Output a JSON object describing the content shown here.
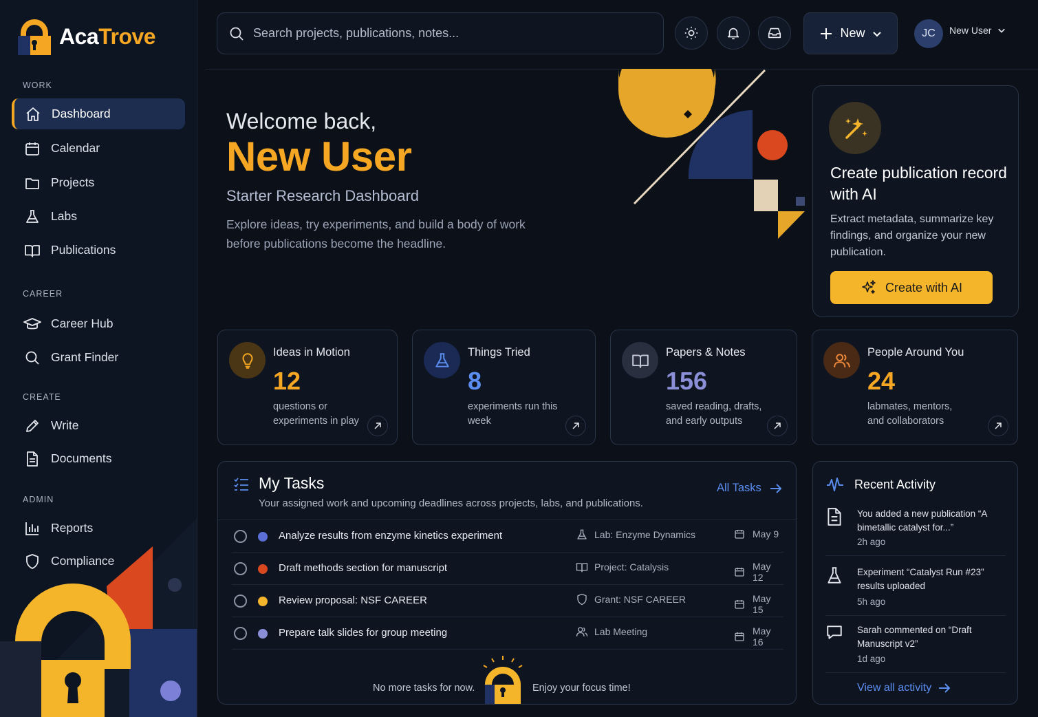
{
  "colors": {
    "background": "#0b1019",
    "sidebar": "#0d1522",
    "accent": "#f5a623",
    "link": "#5b8def",
    "active_nav": "#1c2d4f",
    "orange_red": "#d9481f",
    "navy": "#1f3263"
  },
  "brand": {
    "name_part1": "Aca",
    "name_part2": "Trove",
    "logo_icon": "padlock-logo-icon"
  },
  "sidebar": {
    "sections": [
      {
        "label": "WORK"
      },
      {
        "label": "CAREER"
      },
      {
        "label": "CREATE"
      },
      {
        "label": "ADMIN"
      }
    ],
    "items": [
      {
        "label": "Dashboard",
        "icon": "home-icon",
        "active": true
      },
      {
        "label": "Calendar",
        "icon": "calendar-icon"
      },
      {
        "label": "Projects",
        "icon": "folder-icon"
      },
      {
        "label": "Labs",
        "icon": "flask-icon"
      },
      {
        "label": "Publications",
        "icon": "book-open-icon"
      },
      {
        "label": "Career Hub",
        "icon": "graduation-cap-icon"
      },
      {
        "label": "Grant Finder",
        "icon": "search-icon"
      },
      {
        "label": "Write",
        "icon": "pencil-icon"
      },
      {
        "label": "Documents",
        "icon": "document-icon"
      },
      {
        "label": "Reports",
        "icon": "bar-chart-icon"
      },
      {
        "label": "Compliance",
        "icon": "shield-icon"
      }
    ]
  },
  "topbar": {
    "search_placeholder": "Search projects, publications, notes...",
    "icons": [
      "sun-icon",
      "bell-icon",
      "inbox-icon"
    ],
    "new_label": "New",
    "user_initials": "JC",
    "user_name": "New User"
  },
  "hero": {
    "welcome": "Welcome back,",
    "name": "New User",
    "subtitle": "Starter Research Dashboard",
    "description": "Explore ideas, try experiments, and build a body of work before publications become the headline."
  },
  "ai_card": {
    "title": "Create publication record with AI",
    "description": "Extract metadata, summarize key findings, and organize your new publication.",
    "button": "Create with AI"
  },
  "stats": [
    {
      "title": "Ideas in Motion",
      "value": "12",
      "desc": "questions or experiments in play",
      "icon": "lightbulb-icon",
      "color": "#f5a623"
    },
    {
      "title": "Things Tried",
      "value": "8",
      "desc": "experiments run this week",
      "icon": "flask-icon",
      "color": "#5b8def"
    },
    {
      "title": "Papers & Notes",
      "value": "156",
      "desc": "saved reading, drafts, and early outputs",
      "icon": "book-open-icon",
      "color": "#8b8fd8"
    },
    {
      "title": "People Around You",
      "value": "24",
      "desc": "labmates, mentors, and collaborators",
      "icon": "users-icon",
      "color": "#f5a623"
    }
  ],
  "tasks": {
    "title": "My Tasks",
    "subtitle": "Your assigned work and upcoming deadlines across projects, labs, and publications.",
    "all_label": "All Tasks",
    "rows": [
      {
        "name": "Analyze results from enzyme kinetics experiment",
        "context": "Lab: Enzyme Dynamics",
        "date": "May 9",
        "dot": "#5b6fd6",
        "icon": "flask-icon"
      },
      {
        "name": "Draft methods section for manuscript",
        "context": "Project: Catalysis",
        "date": "May 12",
        "dot": "#d9481f",
        "icon": "book-open-icon"
      },
      {
        "name": "Review proposal: NSF CAREER",
        "context": "Grant: NSF CAREER",
        "date": "May 15",
        "dot": "#f5b52b",
        "icon": "shield-icon"
      },
      {
        "name": "Prepare talk slides for group meeting",
        "context": "Lab Meeting",
        "date": "May 16",
        "dot": "#8b8fd8",
        "icon": "users-icon"
      }
    ],
    "empty_left": "No more tasks for now.",
    "empty_right": "Enjoy your focus time!"
  },
  "activity": {
    "title": "Recent Activity",
    "items": [
      {
        "text": "You added a new publication “A bimetallic catalyst for...”",
        "time": "2h ago",
        "icon": "document-icon"
      },
      {
        "text": "Experiment “Catalyst Run #23” results uploaded",
        "time": "5h ago",
        "icon": "flask-icon"
      },
      {
        "text": "Sarah commented on “Draft Manuscript v2”",
        "time": "1d ago",
        "icon": "comment-icon"
      }
    ],
    "view_all": "View all activity"
  }
}
